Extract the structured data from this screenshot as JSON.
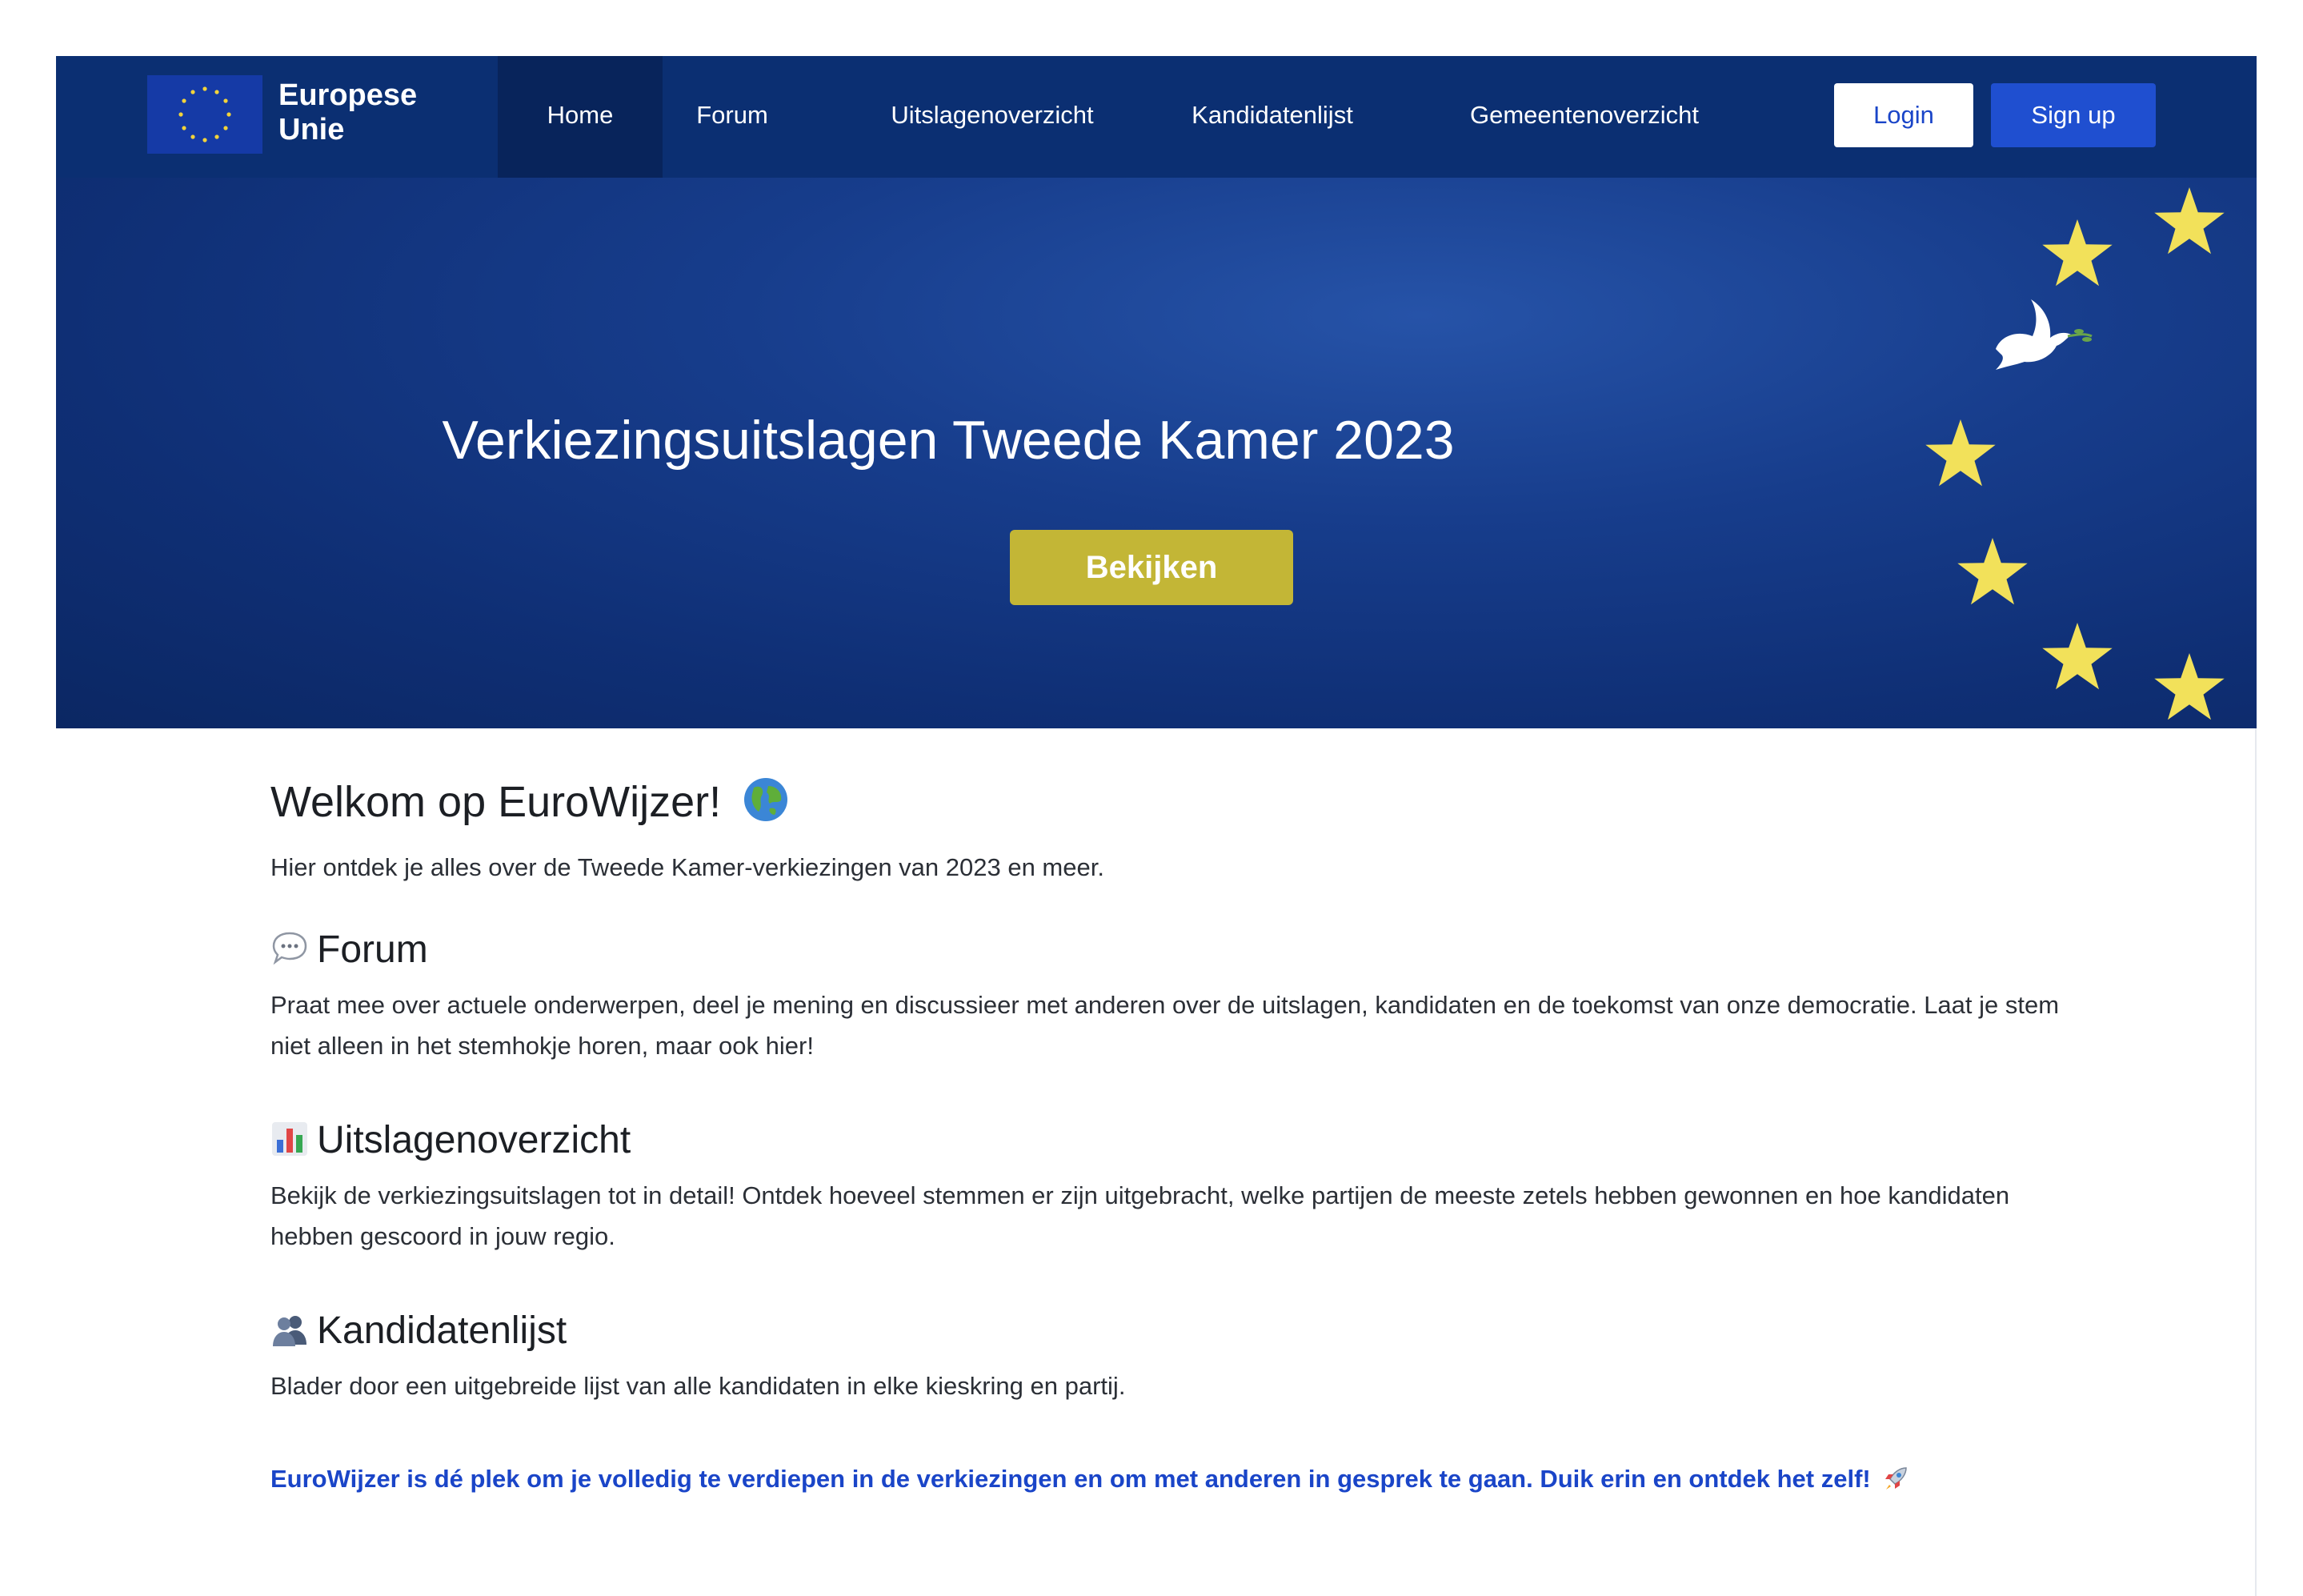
{
  "navbar": {
    "brand_line1": "Europese",
    "brand_line2": "Unie",
    "links": [
      "Home",
      "Forum",
      "Uitslagenoverzicht",
      "Kandidatenlijst",
      "Gemeentenoverzicht"
    ],
    "login_label": "Login",
    "signup_label": "Sign up",
    "active_link": "Home"
  },
  "hero": {
    "title": "Verkiezingsuitslagen Tweede Kamer 2023",
    "button_label": "Bekijken"
  },
  "content": {
    "welcome_title": "Welkom op EuroWijzer!",
    "welcome_text": "Hier ontdek je alles over de Tweede Kamer-verkiezingen van 2023 en meer.",
    "sections": [
      {
        "icon": "speech-bubble-icon",
        "title": "Forum",
        "text": "Praat mee over actuele onderwerpen, deel je mening en discussieer met anderen over de uitslagen, kandidaten en de toekomst van onze democratie. Laat je stem niet alleen in het stemhokje horen, maar ook hier!"
      },
      {
        "icon": "bar-chart-icon",
        "title": "Uitslagenoverzicht",
        "text": "Bekijk de verkiezingsuitslagen tot in detail! Ontdek hoeveel stemmen er zijn uitgebracht, welke partijen de meeste zetels hebben gewonnen en hoe kandidaten hebben gescoord in jouw regio."
      },
      {
        "icon": "people-icon",
        "title": "Kandidatenlijst",
        "text": "Blader door een uitgebreide lijst van alle kandidaten in elke kieskring en partij."
      }
    ],
    "callout": "EuroWijzer is dé plek om je volledig te verdiepen in de verkiezingen en om met anderen in gesprek te gaan. Duik erin en ontdek het zelf!"
  },
  "colors": {
    "navbar_bg": "#0b2f72",
    "hero_bg": "#173d8c",
    "accent_blue": "#1a45c8",
    "button_gold": "#c3b636",
    "star_yellow": "#f2e15a"
  }
}
